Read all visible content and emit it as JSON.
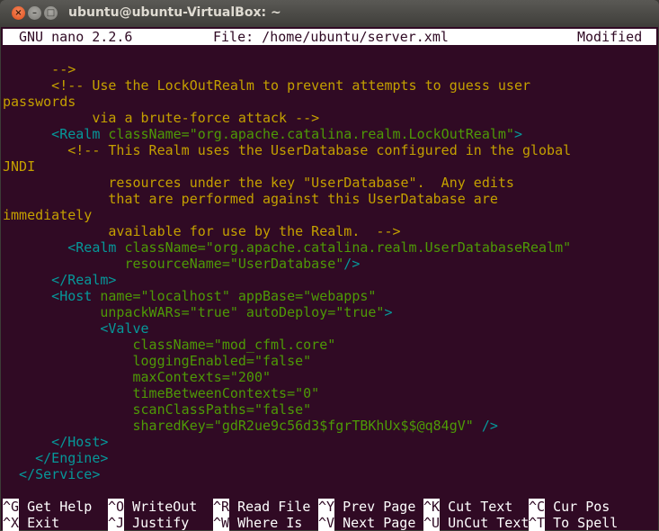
{
  "window": {
    "title": "ubuntu@ubuntu-VirtualBox: ~"
  },
  "nano": {
    "version": "GNU nano 2.2.6",
    "file": "File: /home/ubuntu/server.xml",
    "status": "Modified"
  },
  "colors": {
    "background": "#300a24",
    "comment": "#c4a000",
    "tag": "#06989a",
    "attribute": "#4e9a06"
  },
  "lines": [
    [],
    [
      [
        "      -->",
        "c"
      ]
    ],
    [
      [
        "      <!-- Use the LockOutRealm to prevent attempts to guess user",
        "c"
      ]
    ],
    [
      [
        "passwords",
        "c"
      ]
    ],
    [
      [
        "           via a brute-force attack -->",
        "c"
      ]
    ],
    [
      [
        "      <Realm",
        "t"
      ],
      [
        " className=\"org.apache.catalina.realm.LockOutRealm\"",
        "a"
      ],
      [
        ">",
        "t"
      ]
    ],
    [
      [
        "        <!-- This Realm uses the UserDatabase configured in the global",
        "c"
      ]
    ],
    [
      [
        "JNDI",
        "c"
      ]
    ],
    [
      [
        "             resources under the key \"UserDatabase\".  Any edits",
        "c"
      ]
    ],
    [
      [
        "             that are performed against this UserDatabase are",
        "c"
      ]
    ],
    [
      [
        "immediately",
        "c"
      ]
    ],
    [
      [
        "             available for use by the Realm.  -->",
        "c"
      ]
    ],
    [
      [
        "        <Realm",
        "t"
      ],
      [
        " className=\"org.apache.catalina.realm.UserDatabaseRealm\"",
        "a"
      ]
    ],
    [
      [
        "               resourceName=\"UserDatabase\"",
        "a"
      ],
      [
        "/>",
        "t"
      ]
    ],
    [
      [
        "      </Realm>",
        "t"
      ]
    ],
    [
      [
        "      <Host",
        "t"
      ],
      [
        " name=\"localhost\" appBase=\"webapps\"",
        "a"
      ]
    ],
    [
      [
        "            unpackWARs=\"true\" autoDeploy=\"true\"",
        "a"
      ],
      [
        ">",
        "t"
      ]
    ],
    [
      [
        "            <Valve",
        "t"
      ]
    ],
    [
      [
        "                className=\"mod_cfml.core\"",
        "a"
      ]
    ],
    [
      [
        "                loggingEnabled=\"false\"",
        "a"
      ]
    ],
    [
      [
        "                maxContexts=\"200\"",
        "a"
      ]
    ],
    [
      [
        "                timeBetweenContexts=\"0\"",
        "a"
      ]
    ],
    [
      [
        "                scanClassPaths=\"false\"",
        "a"
      ]
    ],
    [
      [
        "                sharedKey=\"gdR2ue9c56d3$fgrTBKhUx$$@q84gV\"",
        "a"
      ],
      [
        " />",
        "t"
      ]
    ],
    [
      [
        "      </Host>",
        "t"
      ]
    ],
    [
      [
        "    </Engine>",
        "t"
      ]
    ],
    [
      [
        "  </Service>",
        "t"
      ]
    ]
  ],
  "shortcuts": [
    [
      {
        "key": "^G",
        "label": " Get Help"
      },
      {
        "key": "^O",
        "label": " WriteOut"
      },
      {
        "key": "^R",
        "label": " Read File"
      },
      {
        "key": "^Y",
        "label": " Prev Page"
      },
      {
        "key": "^K",
        "label": " Cut Text"
      },
      {
        "key": "^C",
        "label": " Cur Pos"
      }
    ],
    [
      {
        "key": "^X",
        "label": " Exit"
      },
      {
        "key": "^J",
        "label": " Justify"
      },
      {
        "key": "^W",
        "label": " Where Is"
      },
      {
        "key": "^V",
        "label": " Next Page"
      },
      {
        "key": "^U",
        "label": " UnCut Text"
      },
      {
        "key": "^T",
        "label": " To Spell"
      }
    ]
  ]
}
